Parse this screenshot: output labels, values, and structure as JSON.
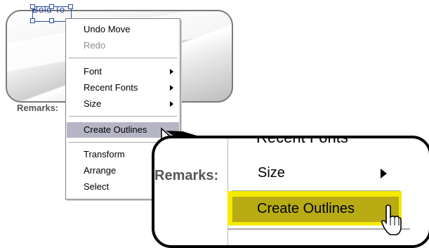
{
  "selected_text": "Bold To",
  "remarks_label": "Remarks:",
  "context_menu": {
    "items": [
      {
        "label": "Undo Move",
        "enabled": true
      },
      {
        "label": "Redo",
        "enabled": false
      },
      {
        "label": "Font",
        "submenu": true
      },
      {
        "label": "Recent Fonts",
        "submenu": true
      },
      {
        "label": "Size",
        "submenu": true
      },
      {
        "label": "Create Outlines",
        "highlighted": true
      },
      {
        "label": "Transform"
      },
      {
        "label": "Arrange"
      },
      {
        "label": "Select"
      }
    ]
  },
  "zoom_callout": {
    "partial_item": "Recent Fonts",
    "remarks_label": "Remarks:",
    "size_label": "Size",
    "create_outlines_label": "Create Outlines",
    "highlight_color": "#f4ea00",
    "selection_color": "#b8ab14"
  },
  "colors": {
    "menu_highlight": "#b5b5c6",
    "selection_handles": "#2b4aa0"
  }
}
